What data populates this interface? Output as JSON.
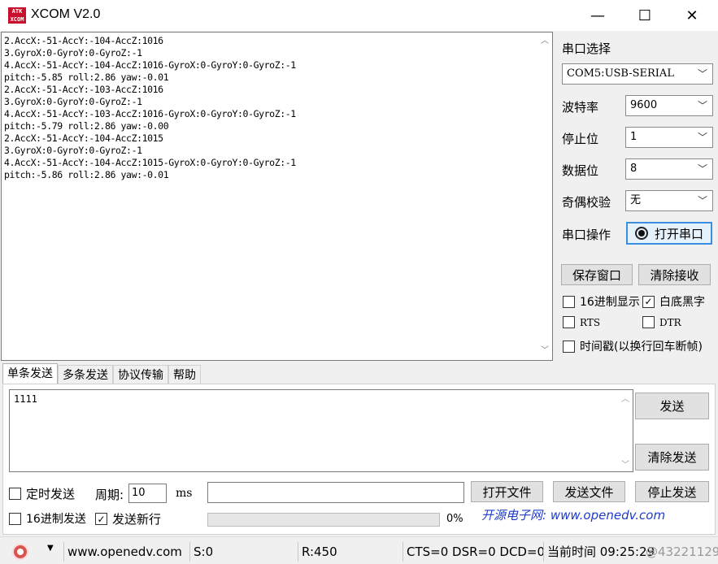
{
  "window": {
    "title": "XCOM V2.0",
    "logo_top": "ATK",
    "logo_bottom": "XCOM",
    "minimize": "—",
    "maximize": "☐",
    "close": "✕"
  },
  "receive": {
    "text": "2.AccX:-51-AccY:-104-AccZ:1016\n3.GyroX:0-GyroY:0-GyroZ:-1\n4.AccX:-51-AccY:-104-AccZ:1016-GyroX:0-GyroY:0-GyroZ:-1\npitch:-5.85 roll:2.86 yaw:-0.01\n2.AccX:-51-AccY:-103-AccZ:1016\n3.GyroX:0-GyroY:0-GyroZ:-1\n4.AccX:-51-AccY:-103-AccZ:1016-GyroX:0-GyroY:0-GyroZ:-1\npitch:-5.79 roll:2.86 yaw:-0.00\n2.AccX:-51-AccY:-104-AccZ:1015\n3.GyroX:0-GyroY:0-GyroZ:-1\n4.AccX:-51-AccY:-104-AccZ:1015-GyroX:0-GyroY:0-GyroZ:-1\npitch:-5.86 roll:2.86 yaw:-0.01"
  },
  "settings": {
    "port_select_label": "串口选择",
    "port_value": "COM5:USB-SERIAL",
    "baud_label": "波特率",
    "baud_value": "9600",
    "stopbits_label": "停止位",
    "stopbits_value": "1",
    "databits_label": "数据位",
    "databits_value": "8",
    "parity_label": "奇偶校验",
    "parity_value": "无",
    "port_op_label": "串口操作",
    "open_port_button": "打开串口",
    "save_window_button": "保存窗口",
    "clear_receive_button": "清除接收",
    "hex_display": "16进制显示",
    "white_black": "白底黑字",
    "rts": "RTS",
    "dtr": "DTR",
    "timestamp": "时间戳(以换行回车断帧)"
  },
  "tabs": [
    "单条发送",
    "多条发送",
    "协议传输",
    "帮助"
  ],
  "send": {
    "text": "1111",
    "send_button": "发送",
    "clear_send_button": "清除发送",
    "timed_send": "定时发送",
    "period_label": "周期:",
    "period_value": "10",
    "period_unit": "ms",
    "open_file_button": "打开文件",
    "send_file_button": "发送文件",
    "stop_send_button": "停止发送",
    "hex_send": "16进制发送",
    "send_newline": "发送新行",
    "progress_text": "0%",
    "progress_value": 0,
    "website_banner": "开源电子网: www.openedv.com"
  },
  "status": {
    "url": "www.openedv.com",
    "sent": "S:0",
    "received": "R:450",
    "signals": "CTS=0 DSR=0 DCD=0",
    "time": "当前时间 09:25:29",
    "watermark": "@43221129"
  }
}
